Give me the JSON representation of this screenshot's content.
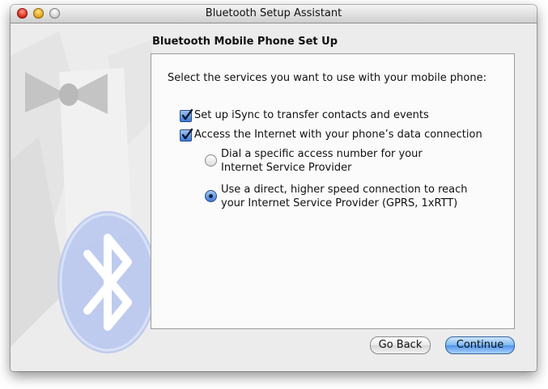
{
  "window": {
    "title": "Bluetooth Setup Assistant"
  },
  "page": {
    "heading": "Bluetooth Mobile Phone Set Up",
    "prompt": "Select the services you want to use with your mobile phone:"
  },
  "options": {
    "isync": {
      "label": "Set up iSync to transfer contacts and events",
      "checked": true
    },
    "internet": {
      "label": "Access the Internet with your phone’s data connection",
      "checked": true
    },
    "dial": {
      "line1": "Dial a specific access number for your",
      "line2": "Internet Service Provider",
      "selected": false
    },
    "direct": {
      "line1": "Use a direct, higher speed connection to reach",
      "line2": "your Internet Service Provider (GPRS, 1xRTT)",
      "selected": true
    }
  },
  "buttons": {
    "back": "Go Back",
    "continue": "Continue"
  },
  "colors": {
    "accent": "#3c7ad8",
    "window_bg": "#ececec"
  },
  "icons": [
    "close-icon",
    "minimize-icon",
    "zoom-icon",
    "bluetooth-icon",
    "bow-tie-icon",
    "checkmark-icon"
  ]
}
